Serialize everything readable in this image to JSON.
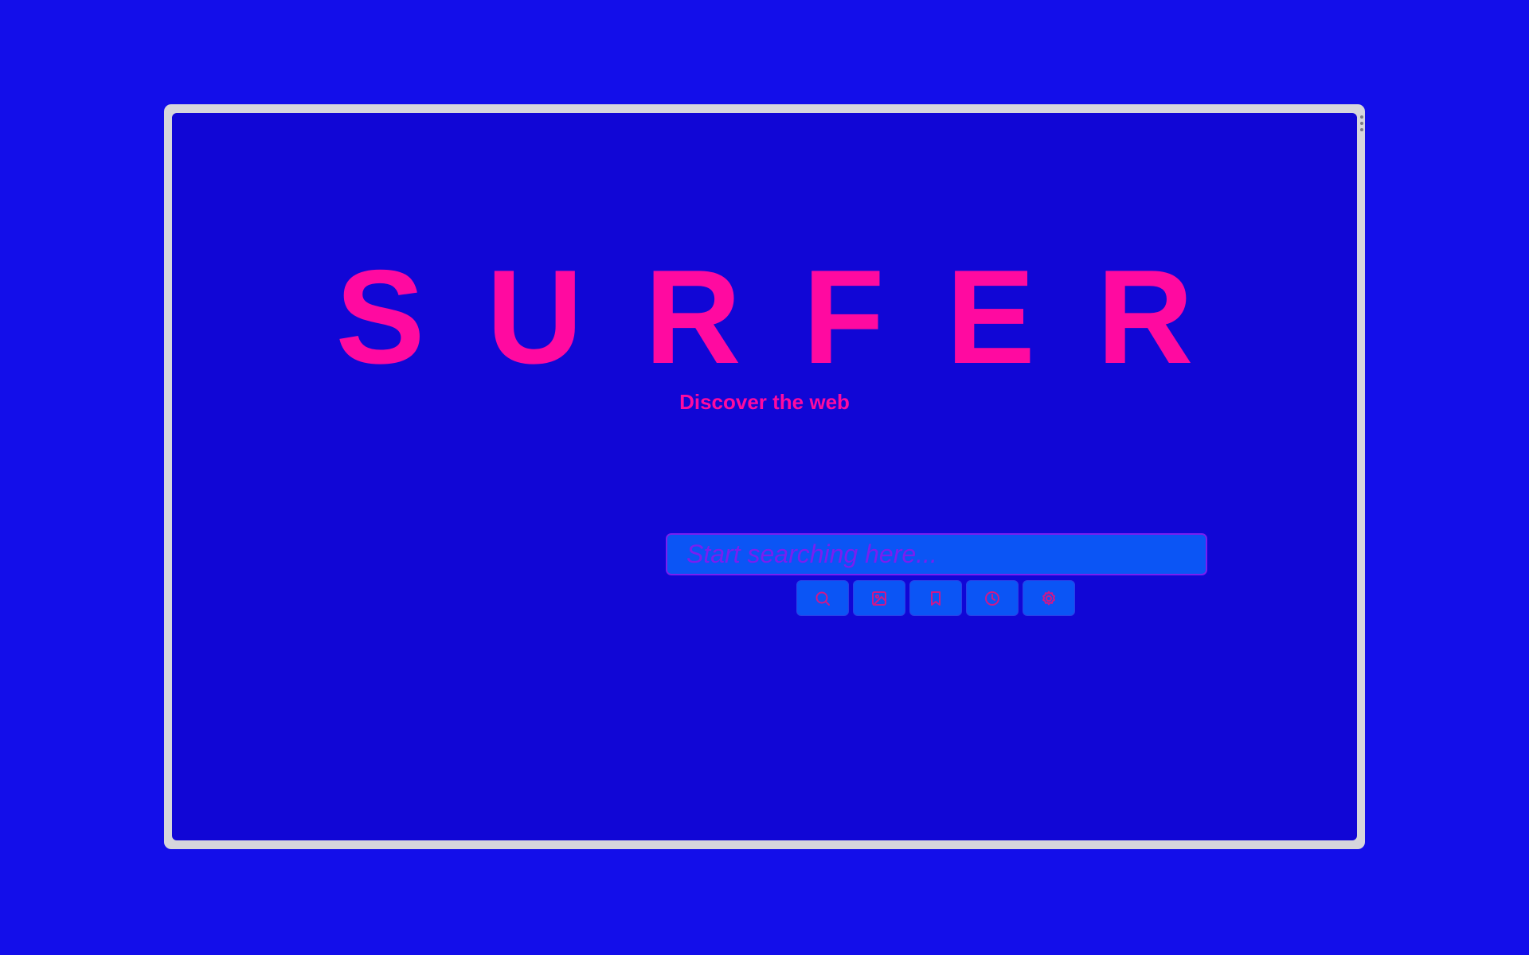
{
  "brand": {
    "logo_text": "SURFER",
    "tagline": "Discover the web"
  },
  "search": {
    "placeholder": "Start searching here...",
    "value": ""
  },
  "toolbar": {
    "buttons": [
      {
        "icon": "search-icon"
      },
      {
        "icon": "image-icon"
      },
      {
        "icon": "bookmark-icon"
      },
      {
        "icon": "history-clock-icon"
      },
      {
        "icon": "settings-gear-icon"
      }
    ]
  },
  "colors": {
    "desktop_background": "#130eea",
    "window_frame": "#d6d6dc",
    "page_background": "#1106d6",
    "accent_pink": "#ff0aa0",
    "input_background": "#0b55f5",
    "input_text": "#7a1ef0"
  }
}
